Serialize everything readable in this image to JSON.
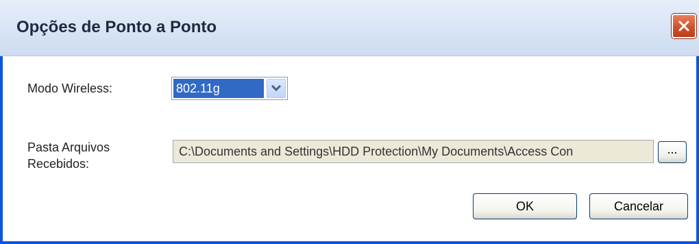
{
  "window": {
    "title": "Opções de Ponto a Ponto"
  },
  "wireless_mode": {
    "label": "Modo Wireless:",
    "selected": "802.11g"
  },
  "received_folder": {
    "label_line1": "Pasta Arquivos",
    "label_line2": "Recebidos:",
    "value": "C:\\Documents and Settings\\HDD Protection\\My Documents\\Access Con",
    "browse_label": "..."
  },
  "buttons": {
    "ok": "OK",
    "cancel": "Cancelar"
  },
  "colors": {
    "title_gradient": "#dbe6f6",
    "close_button": "#d0532a",
    "selection": "#316ac5",
    "frame": "#0a55e3"
  },
  "icons": {
    "close": "close-icon",
    "dropdown": "chevron-down-icon"
  }
}
